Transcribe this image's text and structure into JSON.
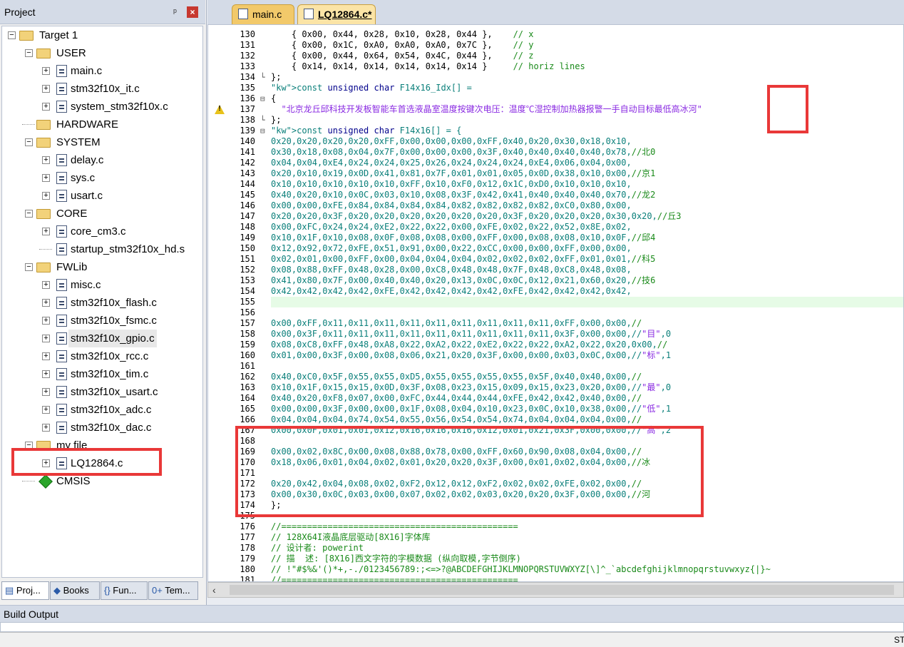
{
  "project_panel": {
    "title": "Project",
    "pin_glyph": "ᵖ",
    "close_glyph": "×",
    "tree": [
      {
        "label": "Target 1",
        "kind": "target",
        "expander": "-"
      },
      {
        "label": "USER",
        "kind": "folder",
        "expander": "-"
      },
      {
        "label": "main.c",
        "kind": "file",
        "expander": "+"
      },
      {
        "label": "stm32f10x_it.c",
        "kind": "file",
        "expander": "+"
      },
      {
        "label": "system_stm32f10x.c",
        "kind": "file",
        "expander": "+"
      },
      {
        "label": "HARDWARE",
        "kind": "folder",
        "expander": ""
      },
      {
        "label": "SYSTEM",
        "kind": "folder",
        "expander": "-"
      },
      {
        "label": "delay.c",
        "kind": "file",
        "expander": "+"
      },
      {
        "label": "sys.c",
        "kind": "file",
        "expander": "+"
      },
      {
        "label": "usart.c",
        "kind": "file",
        "expander": "+"
      },
      {
        "label": "CORE",
        "kind": "folder",
        "expander": "-"
      },
      {
        "label": "core_cm3.c",
        "kind": "file",
        "expander": "+"
      },
      {
        "label": "startup_stm32f10x_hd.s",
        "kind": "file",
        "expander": ""
      },
      {
        "label": "FWLib",
        "kind": "folder",
        "expander": "-"
      },
      {
        "label": "misc.c",
        "kind": "file",
        "expander": "+"
      },
      {
        "label": "stm32f10x_flash.c",
        "kind": "file",
        "expander": "+"
      },
      {
        "label": "stm32f10x_fsmc.c",
        "kind": "file",
        "expander": "+"
      },
      {
        "label": "stm32f10x_gpio.c",
        "kind": "file",
        "expander": "+"
      },
      {
        "label": "stm32f10x_rcc.c",
        "kind": "file",
        "expander": "+"
      },
      {
        "label": "stm32f10x_tim.c",
        "kind": "file",
        "expander": "+"
      },
      {
        "label": "stm32f10x_usart.c",
        "kind": "file",
        "expander": "+"
      },
      {
        "label": "stm32f10x_adc.c",
        "kind": "file",
        "expander": "+"
      },
      {
        "label": "stm32f10x_dac.c",
        "kind": "file",
        "expander": "+"
      },
      {
        "label": "my file",
        "kind": "folder",
        "expander": "-"
      },
      {
        "label": "LQ12864.c",
        "kind": "file",
        "expander": "+"
      },
      {
        "label": "CMSIS",
        "kind": "gem",
        "expander": ""
      }
    ],
    "bottom_tabs": [
      {
        "icon": "▤",
        "label": "Proj..."
      },
      {
        "icon": "◆",
        "label": "Books"
      },
      {
        "icon": "{}",
        "label": "Fun..."
      },
      {
        "icon": "0+",
        "label": "Tem..."
      }
    ]
  },
  "editor": {
    "tabs": [
      {
        "label": "main.c",
        "active": false
      },
      {
        "label": "LQ12864.c*",
        "active": true
      }
    ],
    "lines": [
      {
        "n": "130",
        "fold": "",
        "text": "    { 0x00, 0x44, 0x28, 0x10, 0x28, 0x44 },    // x"
      },
      {
        "n": "131",
        "fold": "",
        "text": "    { 0x00, 0x1C, 0xA0, 0xA0, 0xA0, 0x7C },    // y"
      },
      {
        "n": "132",
        "fold": "",
        "text": "    { 0x00, 0x44, 0x64, 0x54, 0x4C, 0x44 },    // z"
      },
      {
        "n": "133",
        "fold": "",
        "text": "    { 0x14, 0x14, 0x14, 0x14, 0x14, 0x14 }     // horiz lines"
      },
      {
        "n": "134",
        "fold": "└",
        "text": "};"
      },
      {
        "n": "135",
        "fold": "",
        "text": "const unsigned char F14x16_Idx[] ="
      },
      {
        "n": "136",
        "fold": "⊟",
        "text": "{"
      },
      {
        "n": "137",
        "fold": "",
        "text": "  \"北京龙丘邱科技开发板智能车首选液晶室温度按键次电压：温度℃湿控制加热器报警一手自动目标最低高冰河\""
      },
      {
        "n": "138",
        "fold": "└",
        "text": "};"
      },
      {
        "n": "139",
        "fold": "⊟",
        "text": "const unsigned char F14x16[] = {"
      },
      {
        "n": "140",
        "fold": "",
        "text": "0x20,0x20,0x20,0x20,0xFF,0x00,0x00,0x00,0xFF,0x40,0x20,0x30,0x18,0x10,"
      },
      {
        "n": "141",
        "fold": "",
        "text": "0x30,0x18,0x08,0x04,0x7F,0x00,0x00,0x00,0x3F,0x40,0x40,0x40,0x40,0x78,//北0"
      },
      {
        "n": "142",
        "fold": "",
        "text": "0x04,0x04,0xE4,0x24,0x24,0x25,0x26,0x24,0x24,0x24,0xE4,0x06,0x04,0x00,"
      },
      {
        "n": "143",
        "fold": "",
        "text": "0x20,0x10,0x19,0x0D,0x41,0x81,0x7F,0x01,0x01,0x05,0x0D,0x38,0x10,0x00,//京1"
      },
      {
        "n": "144",
        "fold": "",
        "text": "0x10,0x10,0x10,0x10,0x10,0xFF,0x10,0xF0,0x12,0x1C,0xD0,0x10,0x10,0x10,"
      },
      {
        "n": "145",
        "fold": "",
        "text": "0x40,0x20,0x10,0x0C,0x03,0x10,0x08,0x3F,0x42,0x41,0x40,0x40,0x40,0x70,//龙2"
      },
      {
        "n": "146",
        "fold": "",
        "text": "0x00,0x00,0xFE,0x84,0x84,0x84,0x84,0x82,0x82,0x82,0x82,0xC0,0x80,0x00,"
      },
      {
        "n": "147",
        "fold": "",
        "text": "0x20,0x20,0x3F,0x20,0x20,0x20,0x20,0x20,0x20,0x3F,0x20,0x20,0x20,0x30,0x20,//丘3"
      },
      {
        "n": "148",
        "fold": "",
        "text": "0x00,0xFC,0x24,0x24,0xE2,0x22,0x22,0x00,0xFE,0x02,0x22,0x52,0x8E,0x02,"
      },
      {
        "n": "149",
        "fold": "",
        "text": "0x10,0x1F,0x10,0x08,0x0F,0x08,0x08,0x00,0xFF,0x00,0x08,0x08,0x10,0x0F,//邱4"
      },
      {
        "n": "150",
        "fold": "",
        "text": "0x12,0x92,0x72,0xFE,0x51,0x91,0x00,0x22,0xCC,0x00,0x00,0xFF,0x00,0x00,"
      },
      {
        "n": "151",
        "fold": "",
        "text": "0x02,0x01,0x00,0xFF,0x00,0x04,0x04,0x04,0x02,0x02,0x02,0xFF,0x01,0x01,//科5"
      },
      {
        "n": "152",
        "fold": "",
        "text": "0x08,0x88,0xFF,0x48,0x28,0x00,0xC8,0x48,0x48,0x7F,0x48,0xC8,0x48,0x08,"
      },
      {
        "n": "153",
        "fold": "",
        "text": "0x41,0x80,0x7F,0x00,0x40,0x40,0x20,0x13,0x0C,0x0C,0x12,0x21,0x60,0x20,//技6"
      },
      {
        "n": "154",
        "fold": "",
        "text": "0x42,0x42,0x42,0x42,0xFE,0x42,0x42,0x42,0x42,0xFE,0x42,0x42,0x42,0x42,"
      },
      {
        "n": "155",
        "fold": "",
        "text": ""
      },
      {
        "n": "156",
        "fold": "",
        "text": ""
      },
      {
        "n": "157",
        "fold": "",
        "text": "0x00,0xFF,0x11,0x11,0x11,0x11,0x11,0x11,0x11,0x11,0x11,0xFF,0x00,0x00,//"
      },
      {
        "n": "158",
        "fold": "",
        "text": "0x00,0x3F,0x11,0x11,0x11,0x11,0x11,0x11,0x11,0x11,0x11,0x3F,0x00,0x00,//\"目\",0"
      },
      {
        "n": "159",
        "fold": "",
        "text": "0x08,0xC8,0xFF,0x48,0xA8,0x22,0xA2,0x22,0xE2,0x22,0x22,0xA2,0x22,0x20,0x00,//"
      },
      {
        "n": "160",
        "fold": "",
        "text": "0x01,0x00,0x3F,0x00,0x08,0x06,0x21,0x20,0x3F,0x00,0x00,0x03,0x0C,0x00,//\"标\",1"
      },
      {
        "n": "161",
        "fold": "",
        "text": ""
      },
      {
        "n": "162",
        "fold": "",
        "text": "0x40,0xC0,0x5F,0x55,0x55,0xD5,0x55,0x55,0x55,0x55,0x5F,0x40,0x40,0x00,//"
      },
      {
        "n": "163",
        "fold": "",
        "text": "0x10,0x1F,0x15,0x15,0x0D,0x3F,0x08,0x23,0x15,0x09,0x15,0x23,0x20,0x00,//\"最\",0"
      },
      {
        "n": "164",
        "fold": "",
        "text": "0x40,0x20,0xF8,0x07,0x00,0xFC,0x44,0x44,0x44,0xFE,0x42,0x42,0x40,0x00,//"
      },
      {
        "n": "165",
        "fold": "",
        "text": "0x00,0x00,0x3F,0x00,0x00,0x1F,0x08,0x04,0x10,0x23,0x0C,0x10,0x38,0x00,//\"低\",1"
      },
      {
        "n": "166",
        "fold": "",
        "text": "0x04,0x04,0x04,0x74,0x54,0x55,0x56,0x54,0x54,0x74,0x04,0x04,0x04,0x00,//"
      },
      {
        "n": "167",
        "fold": "",
        "text": "0x00,0x0F,0x01,0x01,0x12,0x16,0x16,0x16,0x12,0x01,0x21,0x3F,0x00,0x00,//\"高\",2"
      },
      {
        "n": "168",
        "fold": "",
        "text": ""
      },
      {
        "n": "169",
        "fold": "",
        "text": "0x00,0x02,0x8C,0x00,0x08,0x88,0x78,0x00,0xFF,0x60,0x90,0x08,0x04,0x00,//"
      },
      {
        "n": "170",
        "fold": "",
        "text": "0x18,0x06,0x01,0x04,0x02,0x01,0x20,0x20,0x3F,0x00,0x01,0x02,0x04,0x00,//冰"
      },
      {
        "n": "171",
        "fold": "",
        "text": ""
      },
      {
        "n": "172",
        "fold": "",
        "text": "0x20,0x42,0x04,0x08,0x02,0xF2,0x12,0x12,0xF2,0x02,0x02,0xFE,0x02,0x00,//"
      },
      {
        "n": "173",
        "fold": "",
        "text": "0x00,0x30,0x0C,0x03,0x00,0x07,0x02,0x02,0x03,0x20,0x20,0x3F,0x00,0x00,//河"
      },
      {
        "n": "174",
        "fold": "",
        "text": "};"
      },
      {
        "n": "175",
        "fold": "",
        "text": ""
      },
      {
        "n": "176",
        "fold": "",
        "text": "//=============================================="
      },
      {
        "n": "177",
        "fold": "",
        "text": "// 128X64I液晶底层驱动[8X16]字体库"
      },
      {
        "n": "178",
        "fold": "",
        "text": "// 设计者: powerint"
      },
      {
        "n": "179",
        "fold": "",
        "text": "// 描  述: [8X16]西文字符的字模数据 (纵向取模,字节倒序)"
      },
      {
        "n": "180",
        "fold": "",
        "text": "// !\"#$%&'()*+,-./0123456789:;<=>?@ABCDEFGHIJKLMNOPQRSTUVWXYZ[\\]^_`abcdefghijklmnopqrstuvwxyz{|}~"
      },
      {
        "n": "181",
        "fold": "",
        "text": "//=============================================="
      }
    ]
  },
  "build_output": {
    "title": "Build Output"
  },
  "status_bar": {
    "text": "ST"
  },
  "colors": {
    "code": "#0a7f7a",
    "keyword": "#00008b",
    "string": "#8a2be2",
    "comment": "#1a8a1a",
    "highlight": "#e93838",
    "tab_active": "#fbe4a6"
  }
}
